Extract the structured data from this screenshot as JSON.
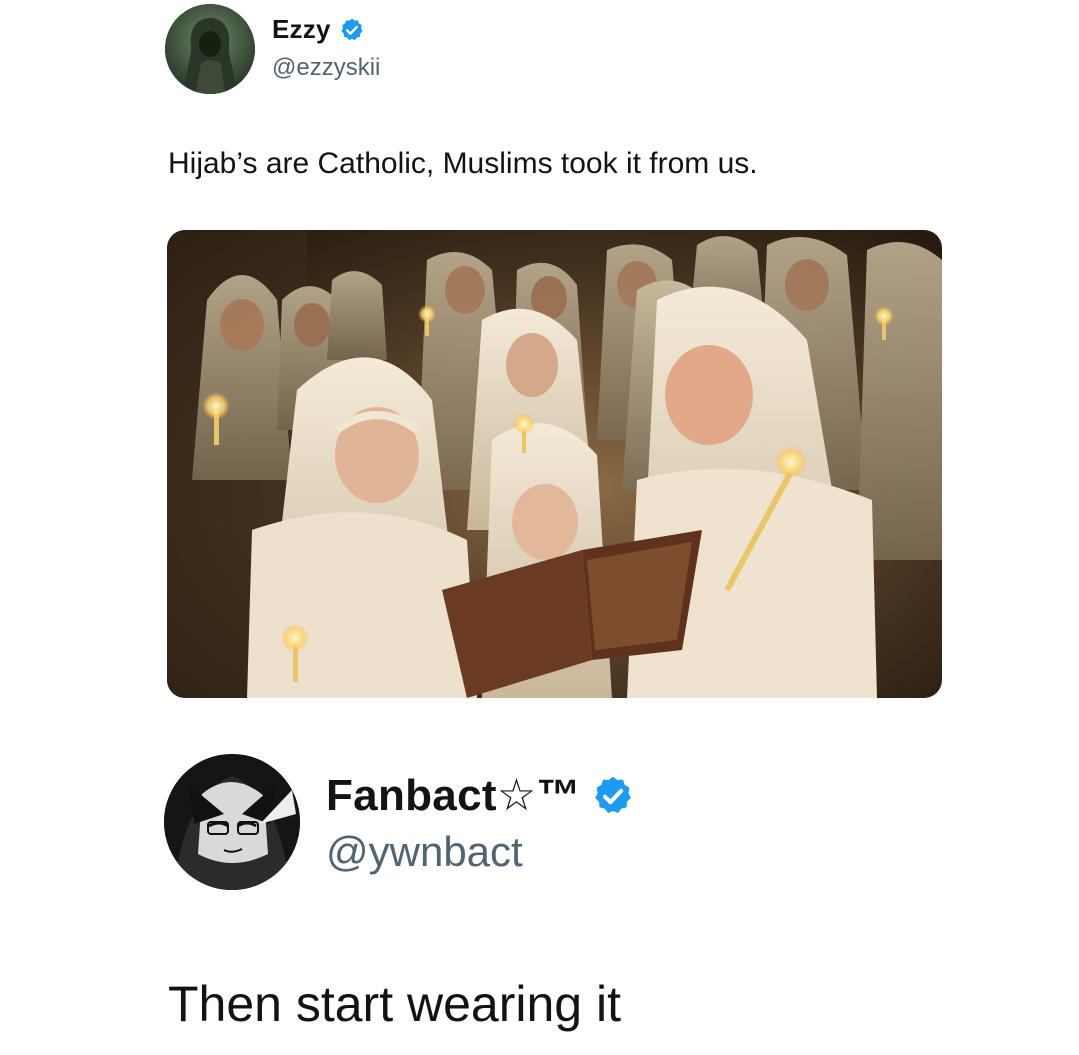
{
  "post_1": {
    "display_name": "Ezzy",
    "handle": "@ezzyskii",
    "verified": true,
    "text": "Hijab’s are Catholic, Muslims took it from us.",
    "avatar_icon": "hooded-figure-avatar",
    "media_icon": "photo-girls-in-white-headscarves-holding-candles"
  },
  "post_2": {
    "display_name": "Fanbact☆™",
    "handle": "@ywnbact",
    "verified": true,
    "text": "Then start wearing it",
    "avatar_icon": "anime-character-avatar"
  },
  "colors": {
    "verified_blue": "#1d9bf0",
    "text_primary": "#0f1419",
    "text_secondary": "#536471"
  }
}
